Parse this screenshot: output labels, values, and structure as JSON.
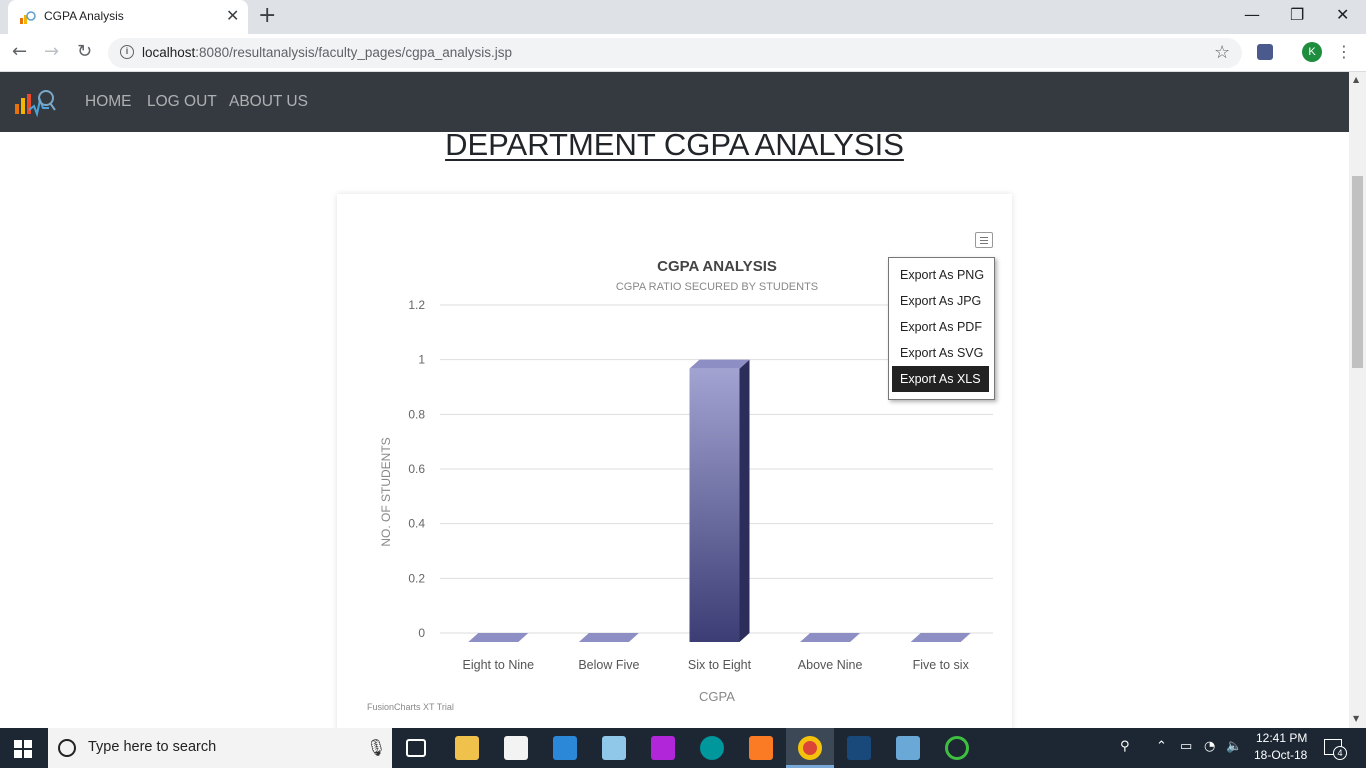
{
  "browser": {
    "tab_title": "CGPA Analysis",
    "url_host": "localhost",
    "url_rest": ":8080/resultanalysis/faculty_pages/cgpa_analysis.jsp",
    "profile_initial": "K"
  },
  "site_nav": {
    "links": [
      {
        "label": "HOME"
      },
      {
        "label": "LOG OUT"
      },
      {
        "label": "ABOUT US"
      }
    ]
  },
  "page": {
    "heading": "DEPARTMENT CGPA ANALYSIS"
  },
  "export_menu": {
    "items": [
      {
        "label": "Export As PNG"
      },
      {
        "label": "Export As JPG"
      },
      {
        "label": "Export As PDF"
      },
      {
        "label": "Export As SVG"
      },
      {
        "label": "Export As XLS"
      }
    ],
    "highlighted": "Export As XLS"
  },
  "chart_data": {
    "type": "bar",
    "title": "CGPA ANALYSIS",
    "subtitle": "CGPA RATIO SECURED BY STUDENTS",
    "xlabel": "CGPA",
    "ylabel": "NO. OF STUDENTS",
    "categories": [
      "Eight to Nine",
      "Below Five",
      "Six to Eight",
      "Above Nine",
      "Five to six"
    ],
    "values": [
      0,
      0,
      1,
      0,
      0
    ],
    "ylim": [
      0,
      1.2
    ],
    "yticks": [
      "0",
      "0.2",
      "0.4",
      "0.6",
      "0.8",
      "1",
      "1.2"
    ],
    "grid": true,
    "style": "3d-column",
    "colors": {
      "bar_front_top": "#a3a3d2",
      "bar_front_bottom": "#3b3d74",
      "bar_side": "#2c2d5a",
      "bar_top": "#8d8ec4"
    },
    "watermark": "FusionCharts XT Trial"
  },
  "taskbar": {
    "search_placeholder": "Type here to search",
    "time": "12:41 PM",
    "date": "18-Oct-18",
    "notification_count": "4"
  },
  "colors": {
    "navbar_bg": "#343a40",
    "taskbar_bg": "#1c2733",
    "menu_highlight": "#222222"
  }
}
